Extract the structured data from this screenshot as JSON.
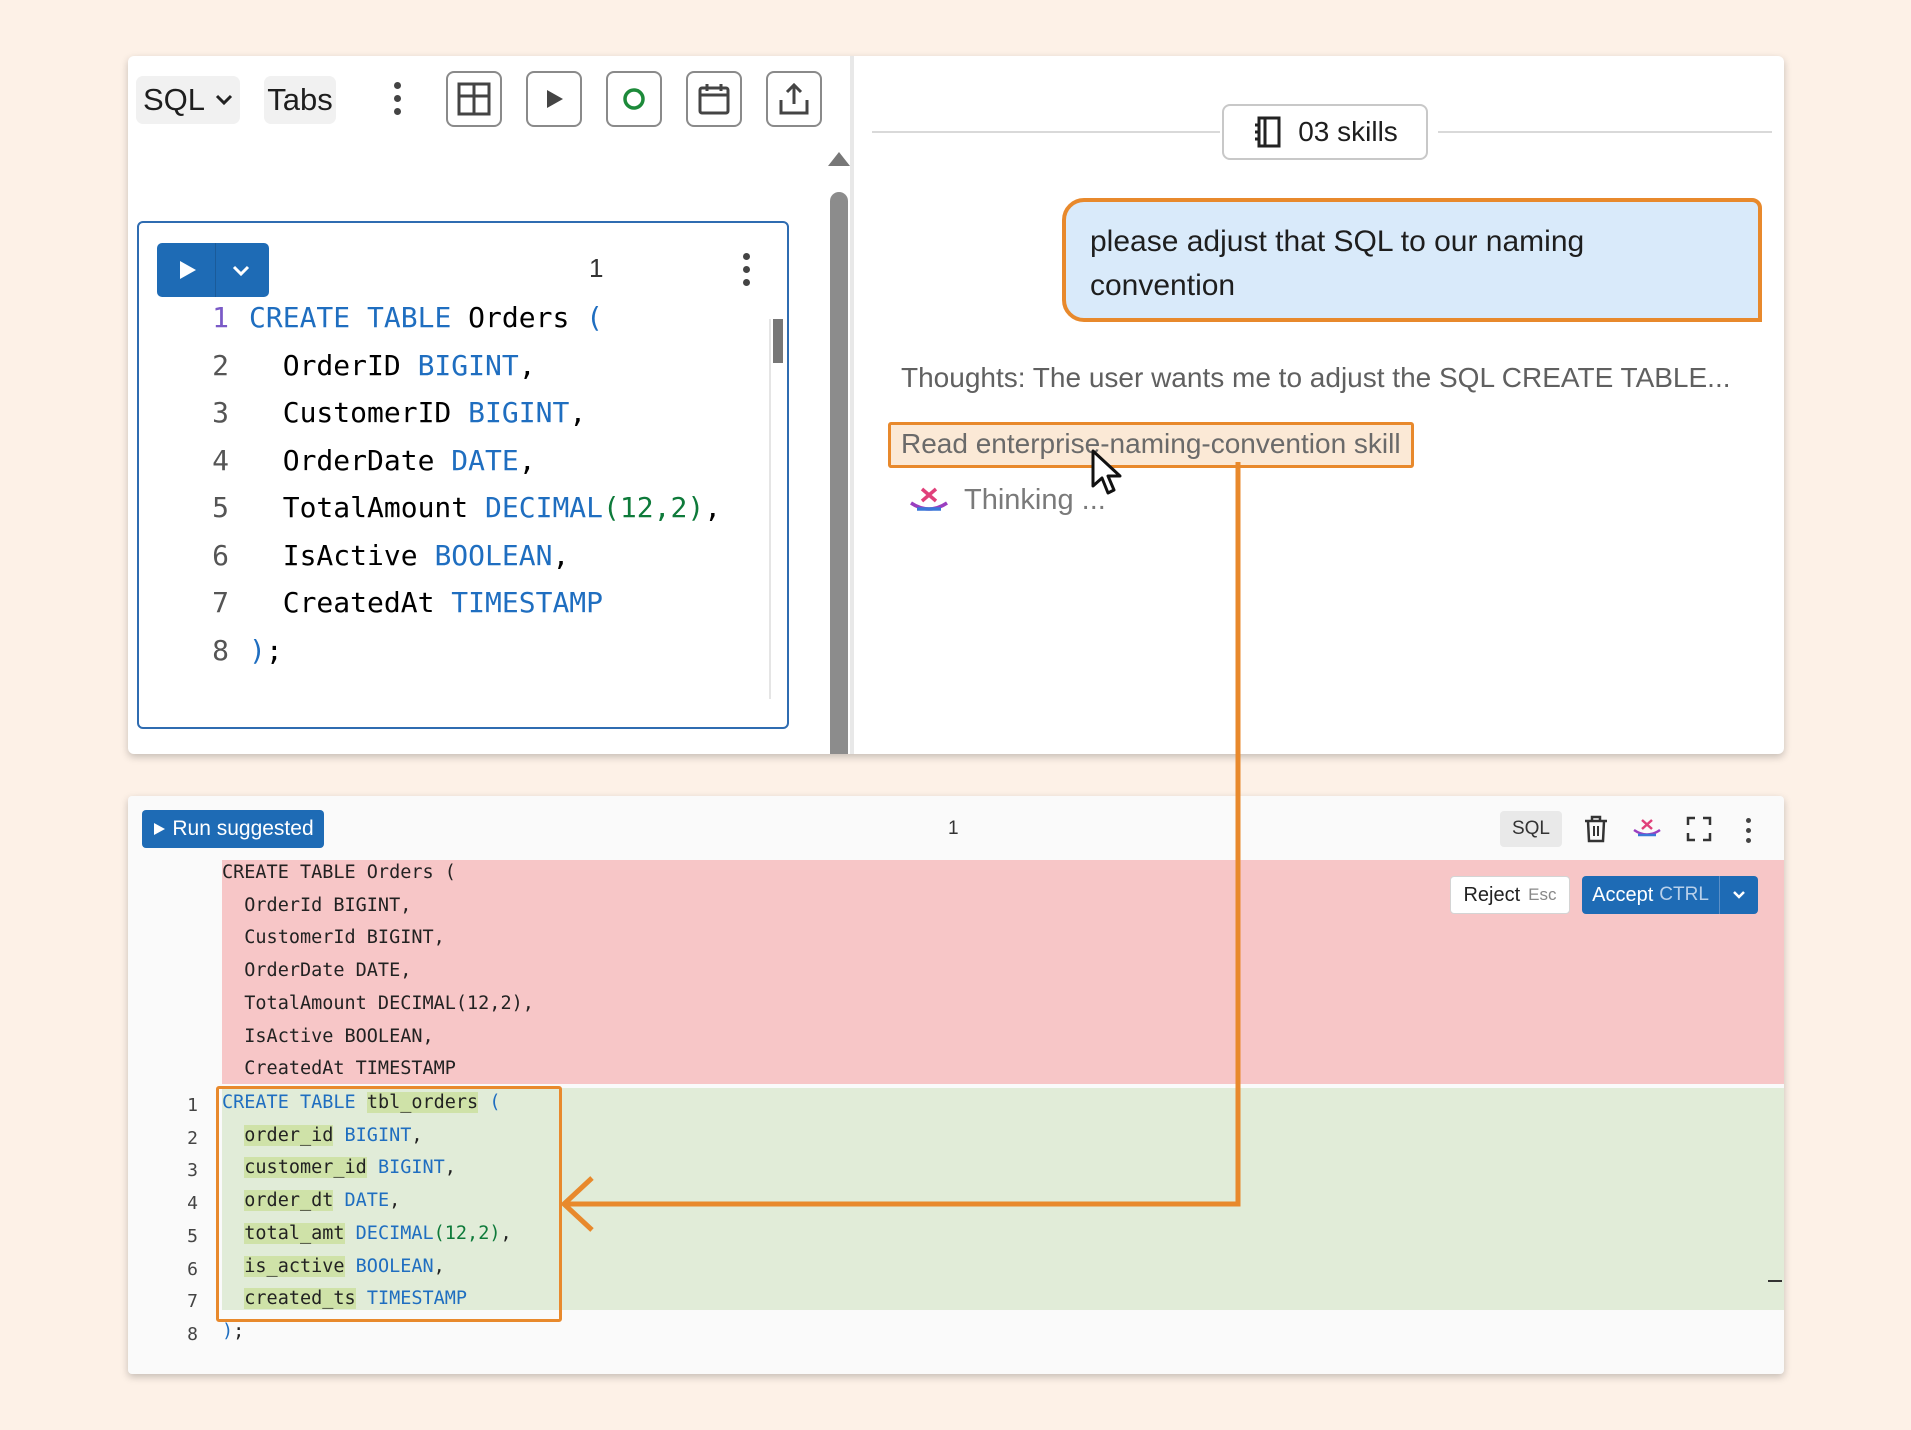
{
  "toolbar": {
    "language_label": "SQL",
    "tabs_label": "Tabs",
    "icons": [
      "layout-icon",
      "play-icon",
      "circle-icon",
      "calendar-icon",
      "share-icon"
    ]
  },
  "editor": {
    "cell_index": "1",
    "lines": [
      {
        "n": "1",
        "segs": [
          [
            "kw",
            "CREATE"
          ],
          [
            "txt",
            " "
          ],
          [
            "kw",
            "TABLE"
          ],
          [
            "txt",
            " Orders "
          ],
          [
            "kw",
            "("
          ]
        ]
      },
      {
        "n": "2",
        "segs": [
          [
            "txt",
            "  OrderID "
          ],
          [
            "kw",
            "BIGINT"
          ],
          [
            "txt",
            ","
          ]
        ]
      },
      {
        "n": "3",
        "segs": [
          [
            "txt",
            "  CustomerID "
          ],
          [
            "kw",
            "BIGINT"
          ],
          [
            "txt",
            ","
          ]
        ]
      },
      {
        "n": "4",
        "segs": [
          [
            "txt",
            "  OrderDate "
          ],
          [
            "kw",
            "DATE"
          ],
          [
            "txt",
            ","
          ]
        ]
      },
      {
        "n": "5",
        "segs": [
          [
            "txt",
            "  TotalAmount "
          ],
          [
            "kw",
            "DECIMAL"
          ],
          [
            "num",
            "(12,2)"
          ],
          [
            "txt",
            ","
          ]
        ]
      },
      {
        "n": "6",
        "segs": [
          [
            "txt",
            "  IsActive "
          ],
          [
            "kw",
            "BOOLEAN"
          ],
          [
            "txt",
            ","
          ]
        ]
      },
      {
        "n": "7",
        "segs": [
          [
            "txt",
            "  CreatedAt "
          ],
          [
            "kw",
            "TIMESTAMP"
          ]
        ]
      },
      {
        "n": "8",
        "segs": [
          [
            "kw",
            ")"
          ],
          [
            "txt",
            ";"
          ]
        ]
      }
    ]
  },
  "chat": {
    "skills_label": "03 skills",
    "user_message": "please adjust that SQL to our naming convention",
    "thoughts": "Thoughts: The user wants me to adjust the SQL CREATE TABLE...",
    "skill_link": "Read enterprise-naming-convention skill",
    "thinking": "Thinking ..."
  },
  "suggestion": {
    "run_label": "Run suggested",
    "cell_index": "1",
    "language_chip": "SQL",
    "reject_label": "Reject",
    "reject_key": "Esc",
    "accept_label": "Accept",
    "accept_key": "CTRL",
    "removed_lines": [
      "CREATE TABLE Orders (",
      "  OrderId BIGINT,",
      "  CustomerId BIGINT,",
      "  OrderDate DATE,",
      "  TotalAmount DECIMAL(12,2),",
      "  IsActive BOOLEAN,",
      "  CreatedAt TIMESTAMP"
    ],
    "added_lines": [
      {
        "n": "1",
        "segs": [
          [
            "kw",
            "CREATE"
          ],
          [
            "txt",
            " "
          ],
          [
            "kw",
            "TABLE"
          ],
          [
            "txt",
            " "
          ],
          [
            "hl",
            "tbl_orders"
          ],
          [
            "txt",
            " "
          ],
          [
            "kw",
            "("
          ]
        ]
      },
      {
        "n": "2",
        "segs": [
          [
            "txt",
            "  "
          ],
          [
            "hl",
            "order_id"
          ],
          [
            "txt",
            " "
          ],
          [
            "kw",
            "BIGINT"
          ],
          [
            "txt",
            ","
          ]
        ]
      },
      {
        "n": "3",
        "segs": [
          [
            "txt",
            "  "
          ],
          [
            "hl",
            "customer_id"
          ],
          [
            "txt",
            " "
          ],
          [
            "kw",
            "BIGINT"
          ],
          [
            "txt",
            ","
          ]
        ]
      },
      {
        "n": "4",
        "segs": [
          [
            "txt",
            "  "
          ],
          [
            "hl",
            "order_dt"
          ],
          [
            "txt",
            " "
          ],
          [
            "kw",
            "DATE"
          ],
          [
            "txt",
            ","
          ]
        ]
      },
      {
        "n": "5",
        "segs": [
          [
            "txt",
            "  "
          ],
          [
            "hl",
            "total_amt"
          ],
          [
            "txt",
            " "
          ],
          [
            "kw",
            "DECIMAL"
          ],
          [
            "num",
            "(12,2)"
          ],
          [
            "txt",
            ","
          ]
        ]
      },
      {
        "n": "6",
        "segs": [
          [
            "txt",
            "  "
          ],
          [
            "hl",
            "is_active"
          ],
          [
            "txt",
            " "
          ],
          [
            "kw",
            "BOOLEAN"
          ],
          [
            "txt",
            ","
          ]
        ]
      },
      {
        "n": "7",
        "segs": [
          [
            "txt",
            "  "
          ],
          [
            "hl",
            "created_ts"
          ],
          [
            "txt",
            " "
          ],
          [
            "kw",
            "TIMESTAMP"
          ]
        ]
      },
      {
        "n": "8",
        "segs": [
          [
            "kw",
            ")"
          ],
          [
            "txt",
            ";"
          ]
        ]
      }
    ]
  },
  "colors": {
    "accent_orange": "#e8892c",
    "primary_blue": "#1e6bb5",
    "removed_bg": "#f7c6c7",
    "added_bg": "#e1ecd8"
  }
}
